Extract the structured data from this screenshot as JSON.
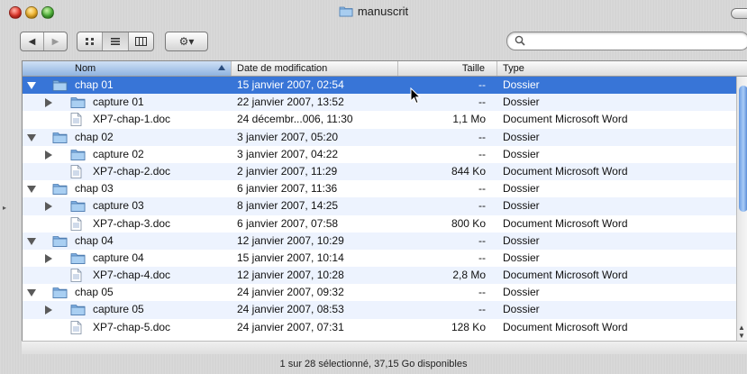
{
  "window": {
    "title": "manuscrit"
  },
  "toolbar": {
    "back_glyph": "◀",
    "forward_glyph": "▶",
    "view_icons": [
      "icon-view-icon",
      "list-view-icon",
      "column-view-icon"
    ],
    "action_glyph": "⚙▾",
    "search_value": ""
  },
  "columns": {
    "name": "Nom",
    "date": "Date de modification",
    "size": "Taille",
    "type": "Type"
  },
  "rows": [
    {
      "indent": 0,
      "disclosure": "open",
      "kind": "folder",
      "name": "chap 01",
      "date": "15 janvier 2007, 02:54",
      "size": "--",
      "type": "Dossier",
      "selected": true
    },
    {
      "indent": 1,
      "disclosure": "closed",
      "kind": "folder",
      "name": "capture 01",
      "date": "22 janvier 2007, 13:52",
      "size": "--",
      "type": "Dossier"
    },
    {
      "indent": 1,
      "disclosure": "none",
      "kind": "doc",
      "name": "XP7-chap-1.doc",
      "date": "24 décembr...006, 11:30",
      "size": "1,1 Mo",
      "type": "Document Microsoft Word"
    },
    {
      "indent": 0,
      "disclosure": "open",
      "kind": "folder",
      "name": "chap 02",
      "date": "3 janvier 2007, 05:20",
      "size": "--",
      "type": "Dossier"
    },
    {
      "indent": 1,
      "disclosure": "closed",
      "kind": "folder",
      "name": "capture 02",
      "date": "3 janvier 2007, 04:22",
      "size": "--",
      "type": "Dossier"
    },
    {
      "indent": 1,
      "disclosure": "none",
      "kind": "doc",
      "name": "XP7-chap-2.doc",
      "date": "2 janvier 2007, 11:29",
      "size": "844 Ko",
      "type": "Document Microsoft Word"
    },
    {
      "indent": 0,
      "disclosure": "open",
      "kind": "folder",
      "name": "chap 03",
      "date": "6 janvier 2007, 11:36",
      "size": "--",
      "type": "Dossier"
    },
    {
      "indent": 1,
      "disclosure": "closed",
      "kind": "folder",
      "name": "capture 03",
      "date": "8 janvier 2007, 14:25",
      "size": "--",
      "type": "Dossier"
    },
    {
      "indent": 1,
      "disclosure": "none",
      "kind": "doc",
      "name": "XP7-chap-3.doc",
      "date": "6 janvier 2007, 07:58",
      "size": "800 Ko",
      "type": "Document Microsoft Word"
    },
    {
      "indent": 0,
      "disclosure": "open",
      "kind": "folder",
      "name": "chap 04",
      "date": "12 janvier 2007, 10:29",
      "size": "--",
      "type": "Dossier"
    },
    {
      "indent": 1,
      "disclosure": "closed",
      "kind": "folder",
      "name": "capture 04",
      "date": "15 janvier 2007, 10:14",
      "size": "--",
      "type": "Dossier"
    },
    {
      "indent": 1,
      "disclosure": "none",
      "kind": "doc",
      "name": "XP7-chap-4.doc",
      "date": "12 janvier 2007, 10:28",
      "size": "2,8 Mo",
      "type": "Document Microsoft Word"
    },
    {
      "indent": 0,
      "disclosure": "open",
      "kind": "folder",
      "name": "chap 05",
      "date": "24 janvier 2007, 09:32",
      "size": "--",
      "type": "Dossier"
    },
    {
      "indent": 1,
      "disclosure": "closed",
      "kind": "folder",
      "name": "capture 05",
      "date": "24 janvier 2007, 08:53",
      "size": "--",
      "type": "Dossier"
    },
    {
      "indent": 1,
      "disclosure": "none",
      "kind": "doc",
      "name": "XP7-chap-5.doc",
      "date": "24 janvier 2007, 07:31",
      "size": "128 Ko",
      "type": "Document Microsoft Word"
    }
  ],
  "status": {
    "text": "1 sur 28 sélectionné, 37,15 Go disponibles"
  },
  "colors": {
    "selection": "#3875d7",
    "alt_row": "#edf3fe",
    "folder": "#8fbbe6"
  }
}
